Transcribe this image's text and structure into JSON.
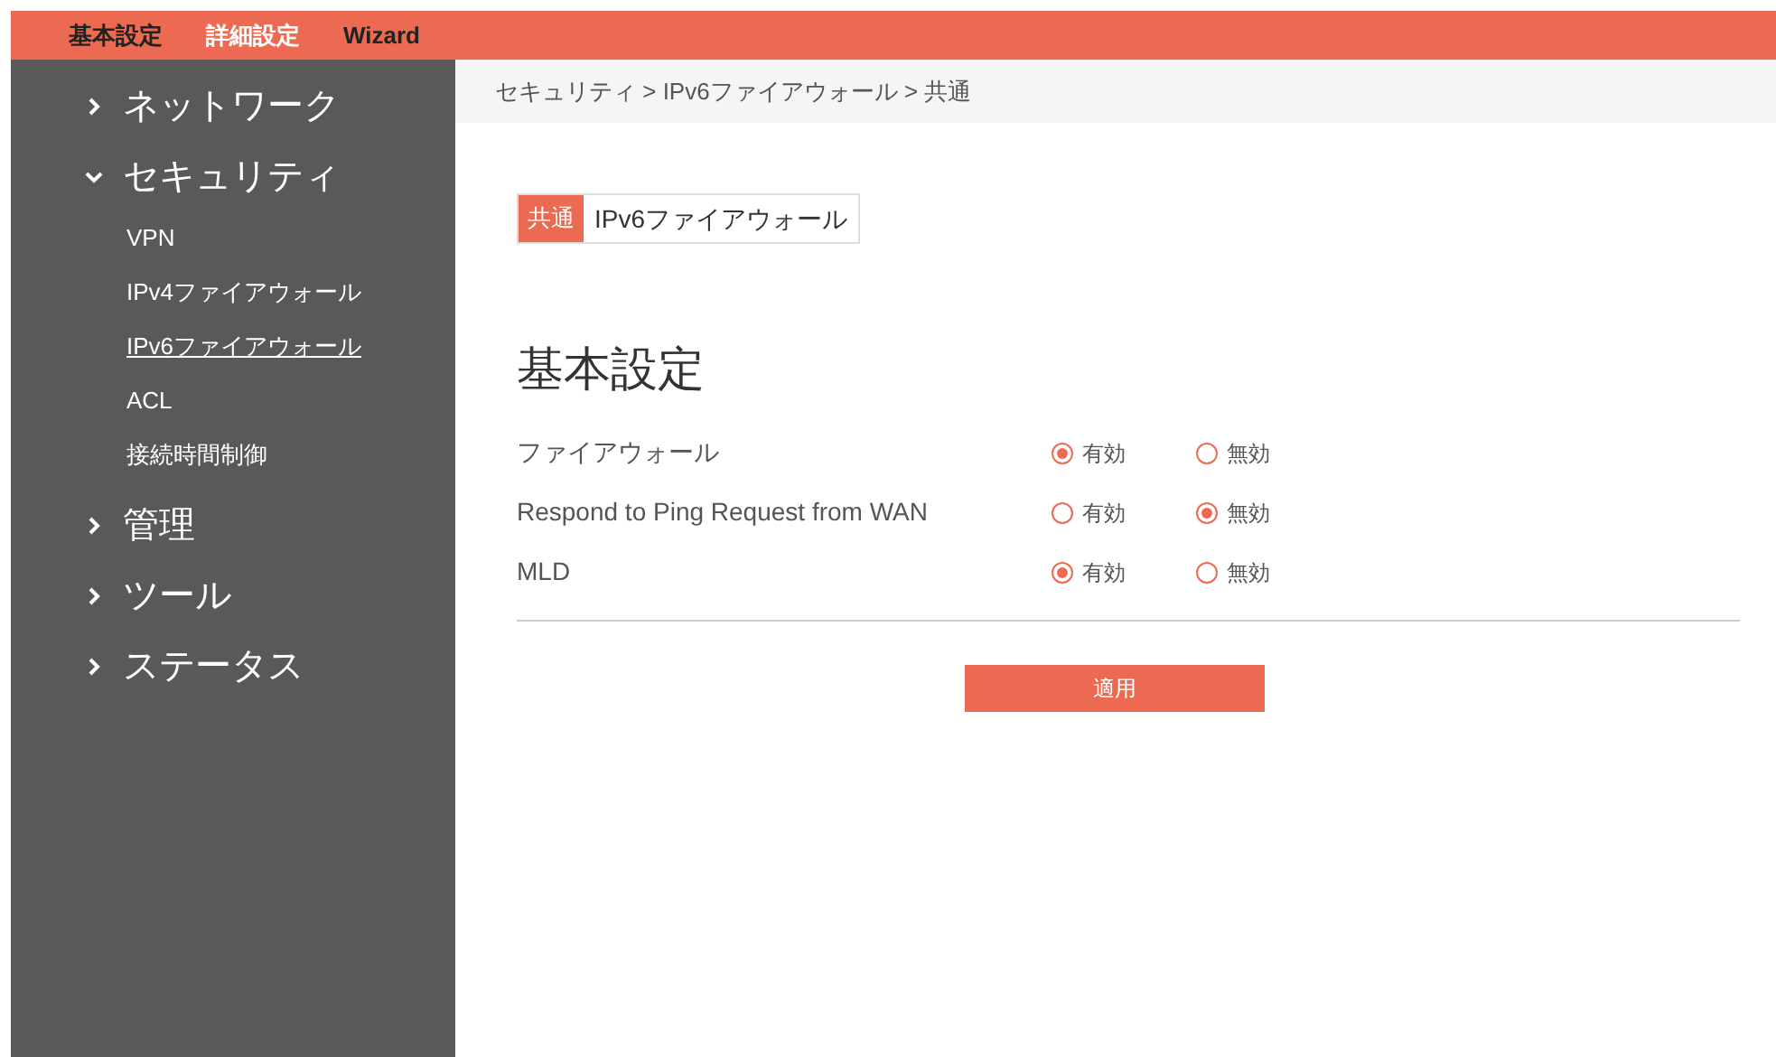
{
  "top_menu": [
    {
      "label": "基本設定",
      "selected": false
    },
    {
      "label": "詳細設定",
      "selected": true
    },
    {
      "label": "Wizard",
      "selected": false
    }
  ],
  "sidebar": {
    "items": [
      {
        "label": "ネットワーク",
        "expanded": false
      },
      {
        "label": "セキュリティ",
        "expanded": true,
        "children": [
          {
            "label": "VPN",
            "selected": false
          },
          {
            "label": "IPv4ファイアウォール",
            "selected": false
          },
          {
            "label": "IPv6ファイアウォール",
            "selected": true
          },
          {
            "label": "ACL",
            "selected": false
          },
          {
            "label": "接続時間制御",
            "selected": false
          }
        ]
      },
      {
        "label": "管理",
        "expanded": false
      },
      {
        "label": "ツール",
        "expanded": false
      },
      {
        "label": "ステータス",
        "expanded": false
      }
    ]
  },
  "breadcrumb": "セキュリティ > IPv6ファイアウォール > 共通",
  "tabs": [
    {
      "label": "共通",
      "selected": true
    },
    {
      "label": "IPv6ファイアウォール",
      "selected": false
    }
  ],
  "section_title": "基本設定",
  "settings": [
    {
      "label": "ファイアウォール",
      "options": [
        {
          "label": "有効",
          "selected": true
        },
        {
          "label": "無効",
          "selected": false
        }
      ]
    },
    {
      "label": "Respond to Ping Request from WAN",
      "options": [
        {
          "label": "有効",
          "selected": false
        },
        {
          "label": "無効",
          "selected": true
        }
      ]
    },
    {
      "label": "MLD",
      "options": [
        {
          "label": "有効",
          "selected": true
        },
        {
          "label": "無効",
          "selected": false
        }
      ]
    }
  ],
  "apply_button": "適用"
}
